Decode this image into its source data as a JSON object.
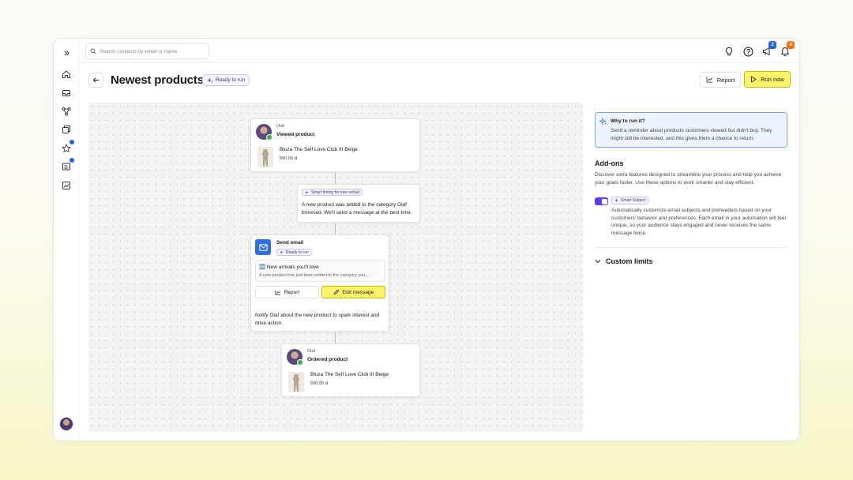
{
  "search": {
    "placeholder": "Search contacts by email or name"
  },
  "topbar": {
    "announcements_badge": "2",
    "notifications_badge": "4",
    "colors": {
      "blue_badge": "#2563eb",
      "orange_badge": "#f97316"
    }
  },
  "header": {
    "title": "Newest products",
    "status": "Ready to run",
    "report_label": "Report",
    "run_label": "Run now"
  },
  "flow": {
    "trigger": {
      "contact": "Olaf",
      "event": "Viewed product",
      "product_name": "Bluza The Self Love Club III Beige",
      "product_price": "590.00 zł"
    },
    "timing": {
      "chip": "Smart timing for new arrival",
      "text": "A new product was added to the category Olaf browsed. We'll send a message at the best time."
    },
    "email": {
      "title": "Send email",
      "status": "Ready to run",
      "subject": "🆕 New arrivals you'll love",
      "preheader": "A new product has just been added to the category you...",
      "report_label": "Report",
      "edit_label": "Edit message",
      "description": "Notify Olaf about the new product to spark interest and drive action."
    },
    "goal": {
      "contact": "Olaf",
      "event": "Ordered product",
      "product_name": "Bluza The Self Love Club III Beige",
      "product_price": "590.00 zł"
    }
  },
  "panel": {
    "why_title": "Why to run it?",
    "why_text": "Send a reminder about products customers viewed but didn't buy. They might still be interested, and this gives them a chance to return.",
    "addons_title": "Add-ons",
    "addons_desc": "Discover extra features designed to streamline your process and help you achieve your goals faster. Use these options to work smarter and stay efficient.",
    "smart_subject_chip": "Smart Subject",
    "smart_subject_desc": "Automatically customize email subjects and preheaders based on your customers' behavior and preferences. Each email in your automation will feel unique, so your audience stays engaged and never receives the same message twice.",
    "smart_subject_enabled": true,
    "custom_limits": "Custom limits"
  }
}
